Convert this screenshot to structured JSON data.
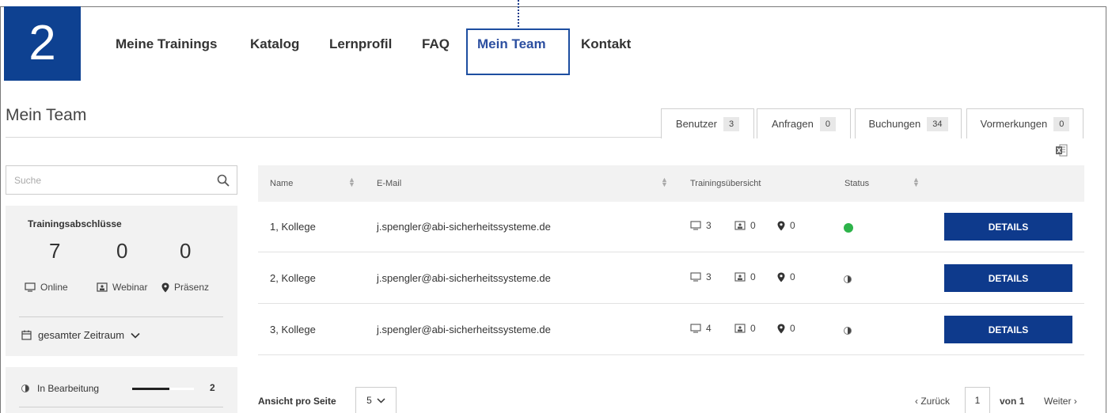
{
  "step_number": "2",
  "nav": {
    "items": [
      "Meine Trainings",
      "Katalog",
      "Lernprofil",
      "FAQ",
      "Mein Team",
      "Kontakt"
    ],
    "active": "Mein Team"
  },
  "page_title": "Mein Team",
  "tabs": [
    {
      "label": "Benutzer",
      "count": "3"
    },
    {
      "label": "Anfragen",
      "count": "0"
    },
    {
      "label": "Buchungen",
      "count": "34"
    },
    {
      "label": "Vormerkungen",
      "count": "0"
    }
  ],
  "search": {
    "placeholder": "Suche"
  },
  "summary": {
    "title": "Trainingsabschlüsse",
    "online_count": "7",
    "webinar_count": "0",
    "praesenz_count": "0",
    "online_label": "Online",
    "webinar_label": "Webinar",
    "praesenz_label": "Präsenz",
    "period_label": "gesamter Zeitraum"
  },
  "status_filter": {
    "label": "In Bearbeitung",
    "count": "2",
    "progress": 0.6
  },
  "table": {
    "headers": {
      "name": "Name",
      "email": "E-Mail",
      "overview": "Trainingsübersicht",
      "status": "Status"
    },
    "rows": [
      {
        "name": "1, Kollege",
        "email": "j.spengler@abi-sicherheitssysteme.de",
        "online": "3",
        "webinar": "0",
        "praesenz": "0",
        "status": "completed",
        "action": "DETAILS"
      },
      {
        "name": "2, Kollege",
        "email": "j.spengler@abi-sicherheitssysteme.de",
        "online": "3",
        "webinar": "0",
        "praesenz": "0",
        "status": "in-progress",
        "action": "DETAILS"
      },
      {
        "name": "3, Kollege",
        "email": "j.spengler@abi-sicherheitssysteme.de",
        "online": "4",
        "webinar": "0",
        "praesenz": "0",
        "status": "in-progress",
        "action": "DETAILS"
      }
    ]
  },
  "pagination": {
    "per_page_label": "Ansicht pro Seite",
    "per_page_value": "5",
    "prev_label": "Zurück",
    "current_page": "1",
    "of_label": "von",
    "total_pages": "1",
    "next_label": "Weiter"
  },
  "colors": {
    "brand_blue": "#0e3a8c",
    "status_green": "#2db34a"
  }
}
